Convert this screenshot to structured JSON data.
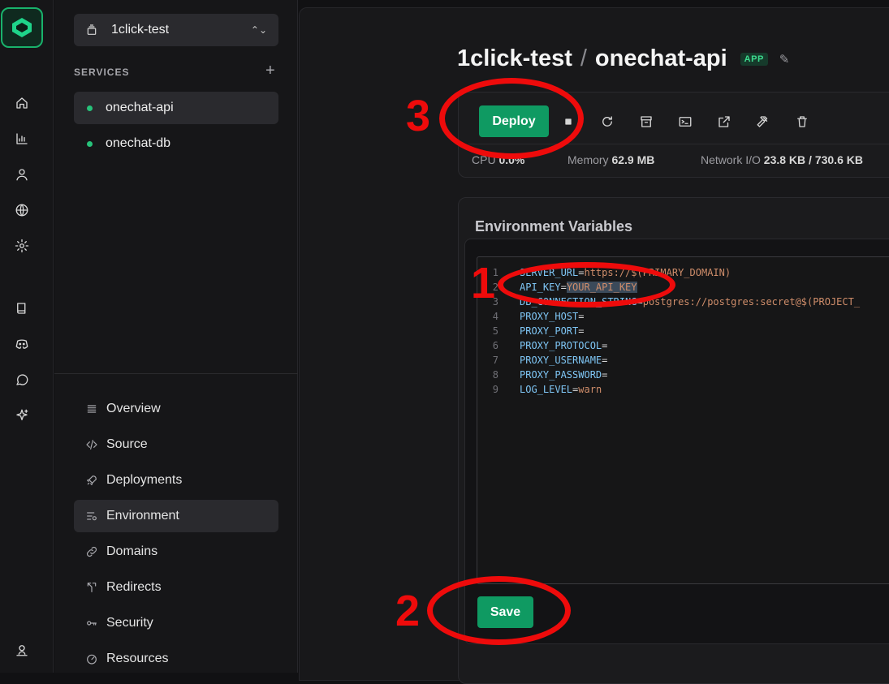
{
  "project": {
    "name": "1click-test"
  },
  "services": {
    "label": "SERVICES",
    "add_label": "+",
    "items": [
      {
        "label": "onechat-api",
        "status": "running"
      },
      {
        "label": "onechat-db",
        "status": "running"
      }
    ]
  },
  "nav": {
    "items": [
      {
        "label": "Overview",
        "icon": "list-icon"
      },
      {
        "label": "Source",
        "icon": "code-icon"
      },
      {
        "label": "Deployments",
        "icon": "rocket-icon"
      },
      {
        "label": "Environment",
        "icon": "sliders-icon"
      },
      {
        "label": "Domains",
        "icon": "link-icon"
      },
      {
        "label": "Redirects",
        "icon": "redirect-icon"
      },
      {
        "label": "Security",
        "icon": "key-icon"
      },
      {
        "label": "Resources",
        "icon": "gauge-icon"
      }
    ]
  },
  "header": {
    "project": "1click-test",
    "separator": "/",
    "service": "onechat-api",
    "badge": "APP"
  },
  "toolbar": {
    "deploy_label": "Deploy"
  },
  "stats": {
    "cpu_label": "CPU",
    "cpu_value": "0.0%",
    "memory_label": "Memory",
    "memory_value": "62.9 MB",
    "network_label": "Network I/O",
    "network_value": "23.8 KB / 730.6 KB"
  },
  "env": {
    "title": "Environment Variables",
    "lines": [
      {
        "n": "1",
        "key": "SERVER_URL",
        "value": "https://$(PRIMARY_DOMAIN)"
      },
      {
        "n": "2",
        "key": "API_KEY",
        "value": "YOUR_API_KEY"
      },
      {
        "n": "3",
        "key": "DB_CONNECTION_STRING",
        "value": "postgres://postgres:secret@$(PROJECT_"
      },
      {
        "n": "4",
        "key": "PROXY_HOST",
        "value": ""
      },
      {
        "n": "5",
        "key": "PROXY_PORT",
        "value": ""
      },
      {
        "n": "6",
        "key": "PROXY_PROTOCOL",
        "value": ""
      },
      {
        "n": "7",
        "key": "PROXY_USERNAME",
        "value": ""
      },
      {
        "n": "8",
        "key": "PROXY_PASSWORD",
        "value": ""
      },
      {
        "n": "9",
        "key": "LOG_LEVEL",
        "value": "warn"
      }
    ],
    "save_label": "Save"
  },
  "annotations": [
    {
      "number": "1",
      "target": "API_KEY line"
    },
    {
      "number": "2",
      "target": "Save button"
    },
    {
      "number": "3",
      "target": "Deploy button"
    }
  ],
  "colors": {
    "accent": "#0f9a62",
    "annotation": "#ee0b0b",
    "status_dot": "#27c27a"
  }
}
